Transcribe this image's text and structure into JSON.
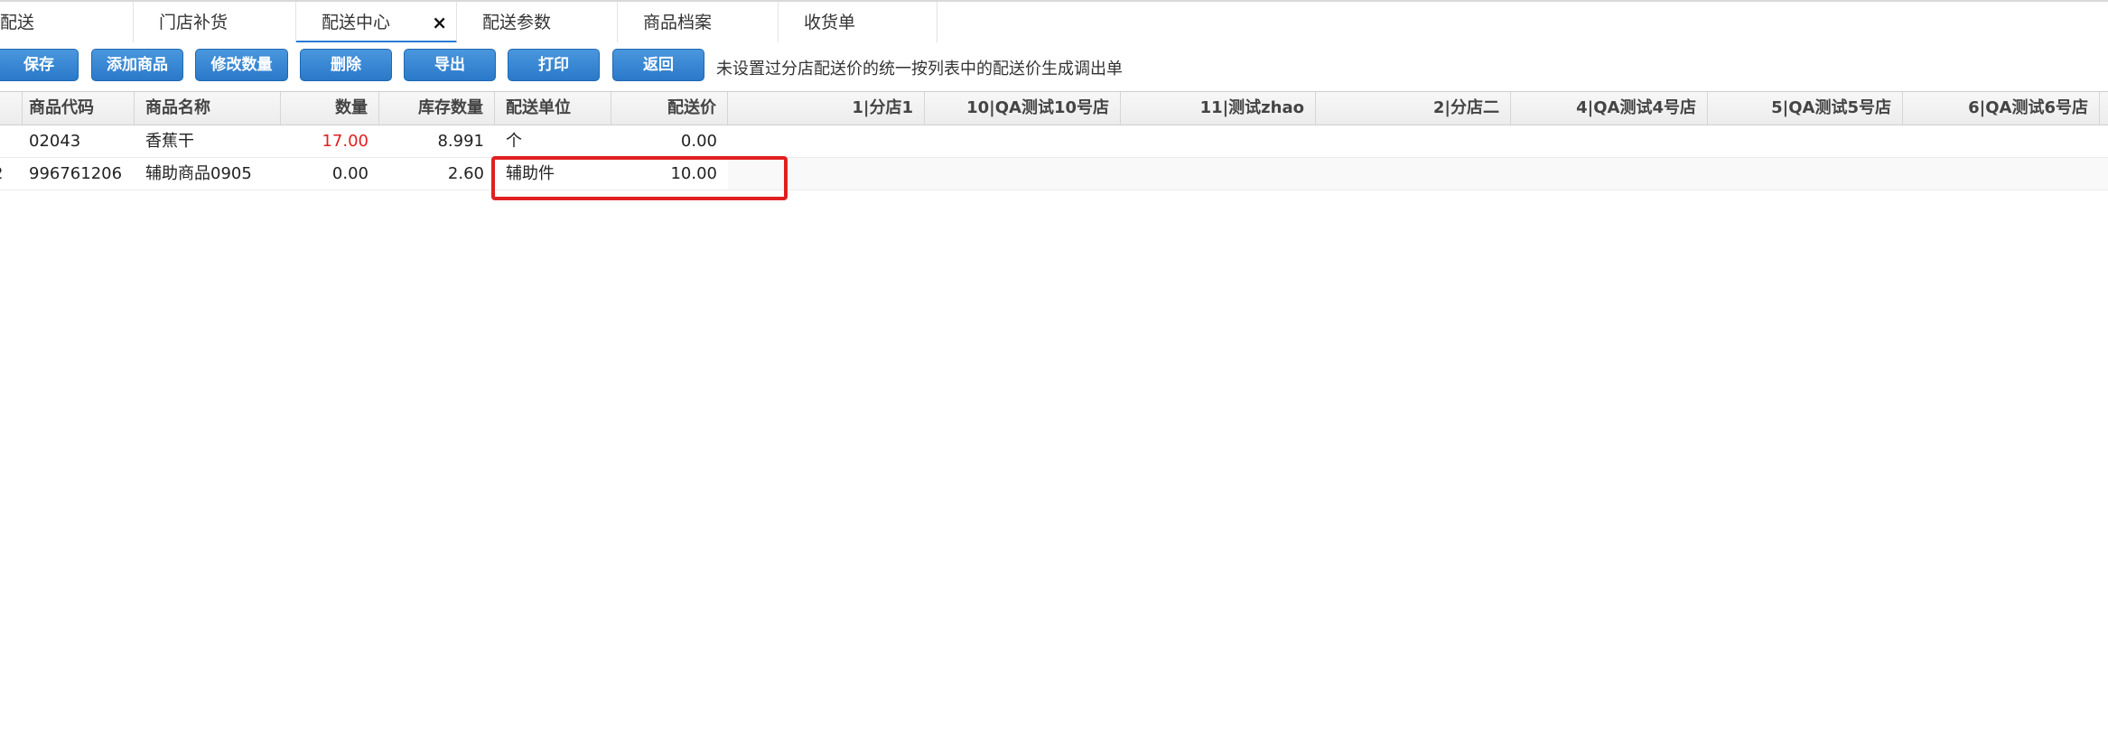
{
  "tabs": [
    {
      "label": "配送"
    },
    {
      "label": "门店补货"
    },
    {
      "label": "配送中心"
    },
    {
      "label": "配送参数"
    },
    {
      "label": "商品档案"
    },
    {
      "label": "收货单"
    }
  ],
  "toolbar": {
    "buttons": [
      {
        "label": "保存"
      },
      {
        "label": "添加商品"
      },
      {
        "label": "修改数量"
      },
      {
        "label": "删除"
      },
      {
        "label": "导出"
      },
      {
        "label": "打印"
      },
      {
        "label": "返回"
      }
    ],
    "tip": "未设置过分店配送价的统一按列表中的配送价生成调出单"
  },
  "grid": {
    "columns": [
      "商品代码",
      "商品名称",
      "数量",
      "库存数量",
      "配送单位",
      "配送价",
      "1|分店1",
      "10|QA测试10号店",
      "11|测试zhao",
      "2|分店二",
      "4|QA测试4号店",
      "5|QA测试5号店",
      "6|QA测试6号店"
    ],
    "rows": [
      {
        "code": "02043",
        "name": "香蕉干",
        "qty": "17.00",
        "stock": "8.991",
        "unit": "个",
        "price": "0.00"
      },
      {
        "code": "996761206",
        "name": "辅助商品0905",
        "qty": "0.00",
        "stock": "2.60",
        "unit": "辅助件",
        "price": "10.00"
      }
    ]
  },
  "colors": {
    "accent": "#2b7bd3",
    "highlight": "#e02020",
    "qty_red": "#e02020"
  }
}
